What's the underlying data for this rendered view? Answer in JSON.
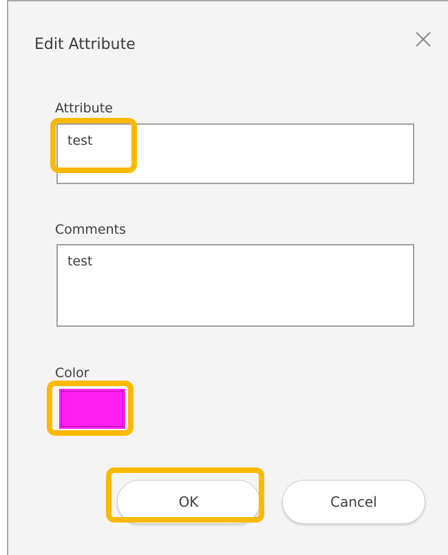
{
  "dialog": {
    "title": "Edit Attribute",
    "close_icon": "close-icon"
  },
  "attribute": {
    "label": "Attribute",
    "value": "test"
  },
  "comments": {
    "label": "Comments",
    "value": "test"
  },
  "color": {
    "label": "Color",
    "value": "#ff1ff2"
  },
  "buttons": {
    "ok_label": "OK",
    "cancel_label": "Cancel"
  },
  "highlight_color": "#fbb900"
}
